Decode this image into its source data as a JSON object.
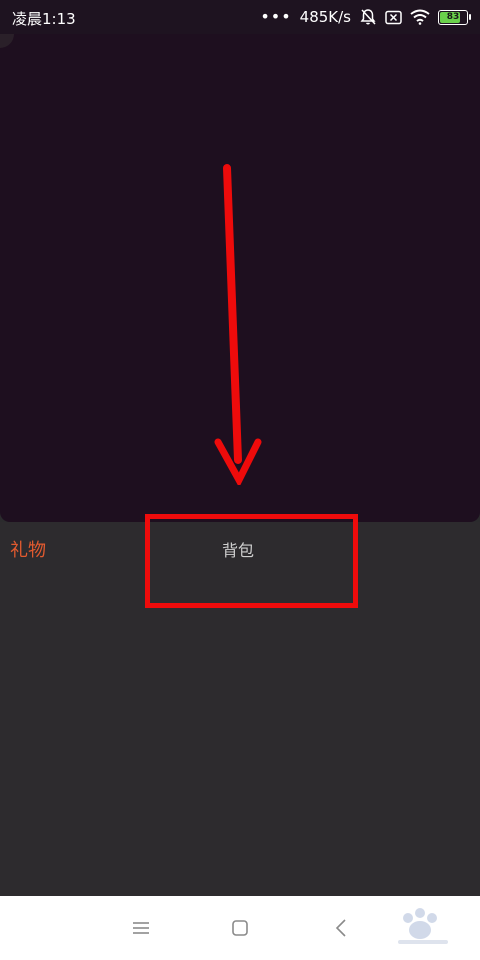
{
  "status_bar": {
    "time": "凌晨1:13",
    "signal_dots": "•••",
    "network_speed": "485K/s",
    "battery_level": "83",
    "icons": [
      "mute-bell-icon",
      "sim-off-icon",
      "wifi-icon",
      "battery-icon"
    ]
  },
  "gift_panel": {
    "tabs": [
      {
        "label": "礼物",
        "active": true
      },
      {
        "label": "背包",
        "active": false
      }
    ]
  },
  "colors": {
    "active_tab": "#e15a2f",
    "highlight": "#ee0b0b",
    "video_bg": "#1e0f1f",
    "panel_bg": "#2d2b2e",
    "battery_fill": "#6ad14b"
  },
  "nav_bar": {
    "buttons": [
      "menu-icon",
      "home-icon",
      "back-icon"
    ]
  }
}
